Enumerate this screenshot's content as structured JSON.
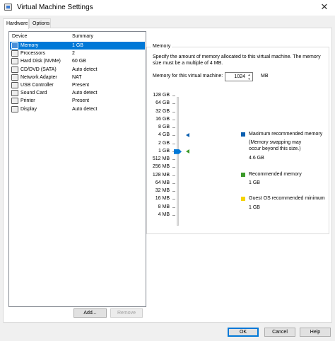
{
  "window": {
    "title": "Virtual Machine Settings",
    "close_glyph": "✕"
  },
  "tabs": [
    {
      "label": "Hardware"
    },
    {
      "label": "Options"
    }
  ],
  "device_list": {
    "header_device": "Device",
    "header_summary": "Summary",
    "rows": [
      {
        "icon": "memory-icon",
        "name": "Memory",
        "summary": "1 GB",
        "selected": true
      },
      {
        "icon": "processor-icon",
        "name": "Processors",
        "summary": "2"
      },
      {
        "icon": "hard-disk-icon",
        "name": "Hard Disk (NVMe)",
        "summary": "60 GB"
      },
      {
        "icon": "cd-dvd-icon",
        "name": "CD/DVD (SATA)",
        "summary": "Auto detect"
      },
      {
        "icon": "network-adapter-icon",
        "name": "Network Adapter",
        "summary": "NAT"
      },
      {
        "icon": "usb-controller-icon",
        "name": "USB Controller",
        "summary": "Present"
      },
      {
        "icon": "sound-card-icon",
        "name": "Sound Card",
        "summary": "Auto detect"
      },
      {
        "icon": "printer-icon",
        "name": "Printer",
        "summary": "Present"
      },
      {
        "icon": "display-icon",
        "name": "Display",
        "summary": "Auto detect"
      }
    ]
  },
  "buttons": {
    "add": "Add...",
    "remove": "Remove",
    "ok": "OK",
    "cancel": "Cancel",
    "help": "Help"
  },
  "memory": {
    "group_title": "Memory",
    "description": "Specify the amount of memory allocated to this virtual machine. The memory size must be a multiple of 4 MB.",
    "field_label": "Memory for this virtual machine:",
    "value": "1024",
    "unit": "MB",
    "scale_labels": [
      "128 GB",
      "64 GB",
      "32 GB",
      "16 GB",
      "8 GB",
      "4 GB",
      "2 GB",
      "1 GB",
      "512 MB",
      "256 MB",
      "128 MB",
      "64 MB",
      "32 MB",
      "16 MB",
      "8 MB",
      "4 MB"
    ],
    "slider_value": "1 GB",
    "max_recommended_marker": "4 GB",
    "recommended_marker": "1 GB",
    "legend": {
      "max_title": "Maximum recommended memory",
      "max_note_1": "(Memory swapping may",
      "max_note_2": "occur beyond this size.)",
      "max_value": "4.6 GB",
      "rec_title": "Recommended memory",
      "rec_value": "1 GB",
      "guest_title": "Guest OS recommended minimum",
      "guest_value": "1 GB"
    },
    "colors": {
      "max": "#0a5fb0",
      "recommended": "#3c9a2a",
      "guest": "#f5d400",
      "selection": "#0078d7"
    }
  }
}
